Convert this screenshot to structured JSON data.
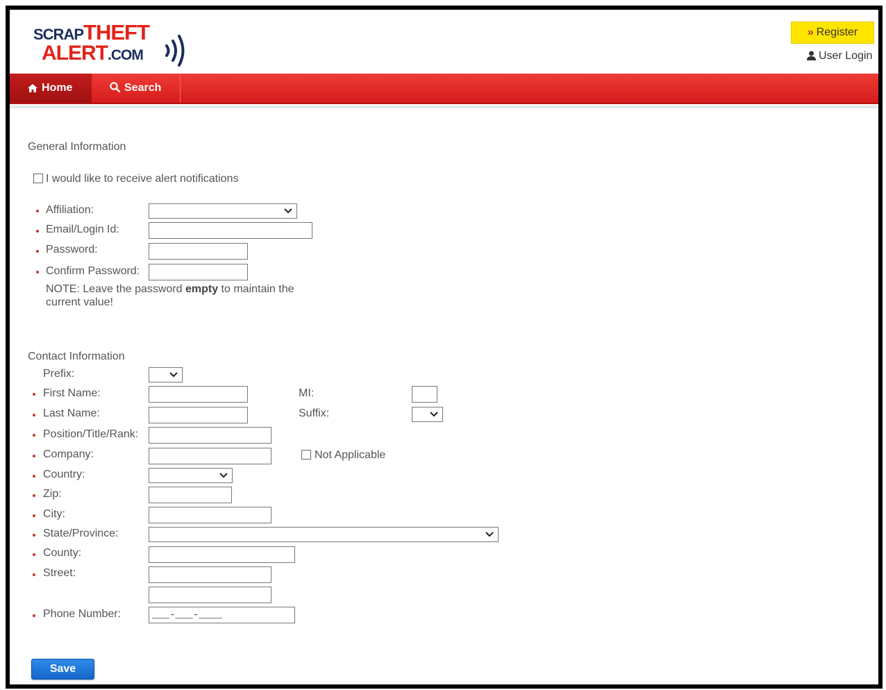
{
  "logo": {
    "scrap": "SCRAP",
    "theft": "THEFT",
    "alert": "ALERT",
    "com": ".COM"
  },
  "header": {
    "register_label": "Register",
    "login_label": "User Login"
  },
  "nav": {
    "home": "Home",
    "search": "Search"
  },
  "general": {
    "title": "General Information",
    "alert_checkbox_label": "I would like to receive alert notifications",
    "affiliation_label": "Affiliation:",
    "email_label": "Email/Login Id:",
    "password_label": "Password:",
    "confirm_label": "Confirm Password:",
    "note_prefix": "NOTE: Leave the password ",
    "note_bold": "empty",
    "note_suffix": " to maintain the current value!"
  },
  "contact": {
    "title": "Contact Information",
    "prefix_label": "Prefix:",
    "first_name_label": "First Name:",
    "mi_label": "MI:",
    "last_name_label": "Last Name:",
    "suffix_label": "Suffix:",
    "position_label": "Position/Title/Rank:",
    "company_label": "Company:",
    "not_applicable_label": "Not Applicable",
    "country_label": "Country:",
    "zip_label": "Zip:",
    "city_label": "City:",
    "state_label": "State/Province:",
    "county_label": "County:",
    "street_label": "Street:",
    "phone_label": "Phone Number:",
    "phone_value": "___-___-____"
  },
  "actions": {
    "save_label": "Save"
  },
  "colors": {
    "brand_red": "#e2231a",
    "brand_navy": "#1b2d5c",
    "register_yellow": "#ffe400",
    "save_blue": "#1f78dc"
  }
}
